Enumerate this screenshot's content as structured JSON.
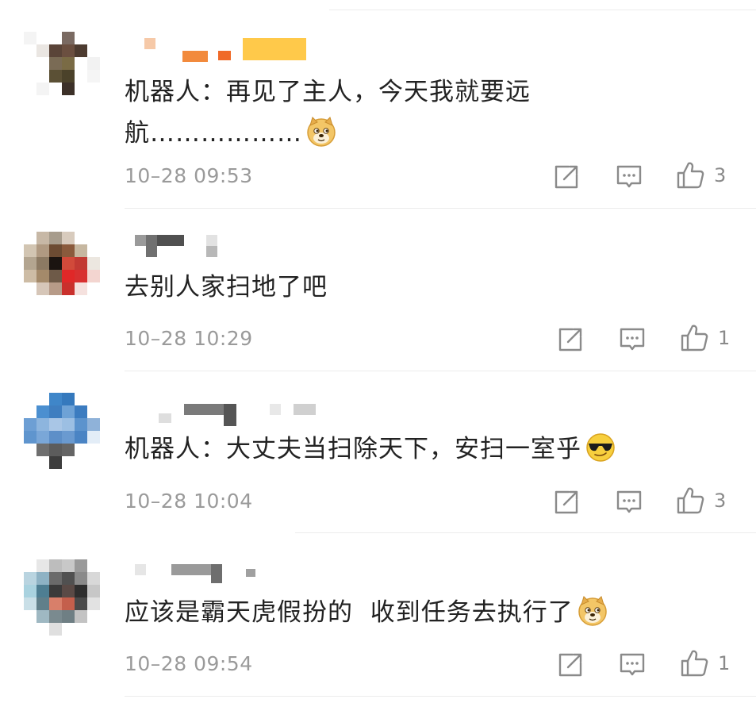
{
  "comments": [
    {
      "text_line1": "机器人：再见了主人，今天我就要远",
      "text_line2": "航………………",
      "emoji": "doge-emoji",
      "timestamp": "10–28 09:53",
      "likes": "3"
    },
    {
      "text_line1": "去别人家扫地了吧",
      "timestamp": "10–28 10:29",
      "likes": "1"
    },
    {
      "text_line1": "机器人：大丈夫当扫除天下，安扫一室乎",
      "emoji": "cool-sunglasses-emoji",
      "timestamp": "10–28 10:04",
      "likes": "3"
    },
    {
      "text_line1": "应该是霸天虎假扮的  收到任务去执行了",
      "emoji": "doge-emoji",
      "timestamp": "10–28 09:54",
      "likes": "1"
    }
  ],
  "icons": {
    "share": "share-icon",
    "reply": "comment-icon",
    "like": "thumbs-up-icon"
  },
  "colors": {
    "meta_text": "#9a9a9a",
    "body_text": "#222222",
    "icon": "#8a8a8a"
  }
}
